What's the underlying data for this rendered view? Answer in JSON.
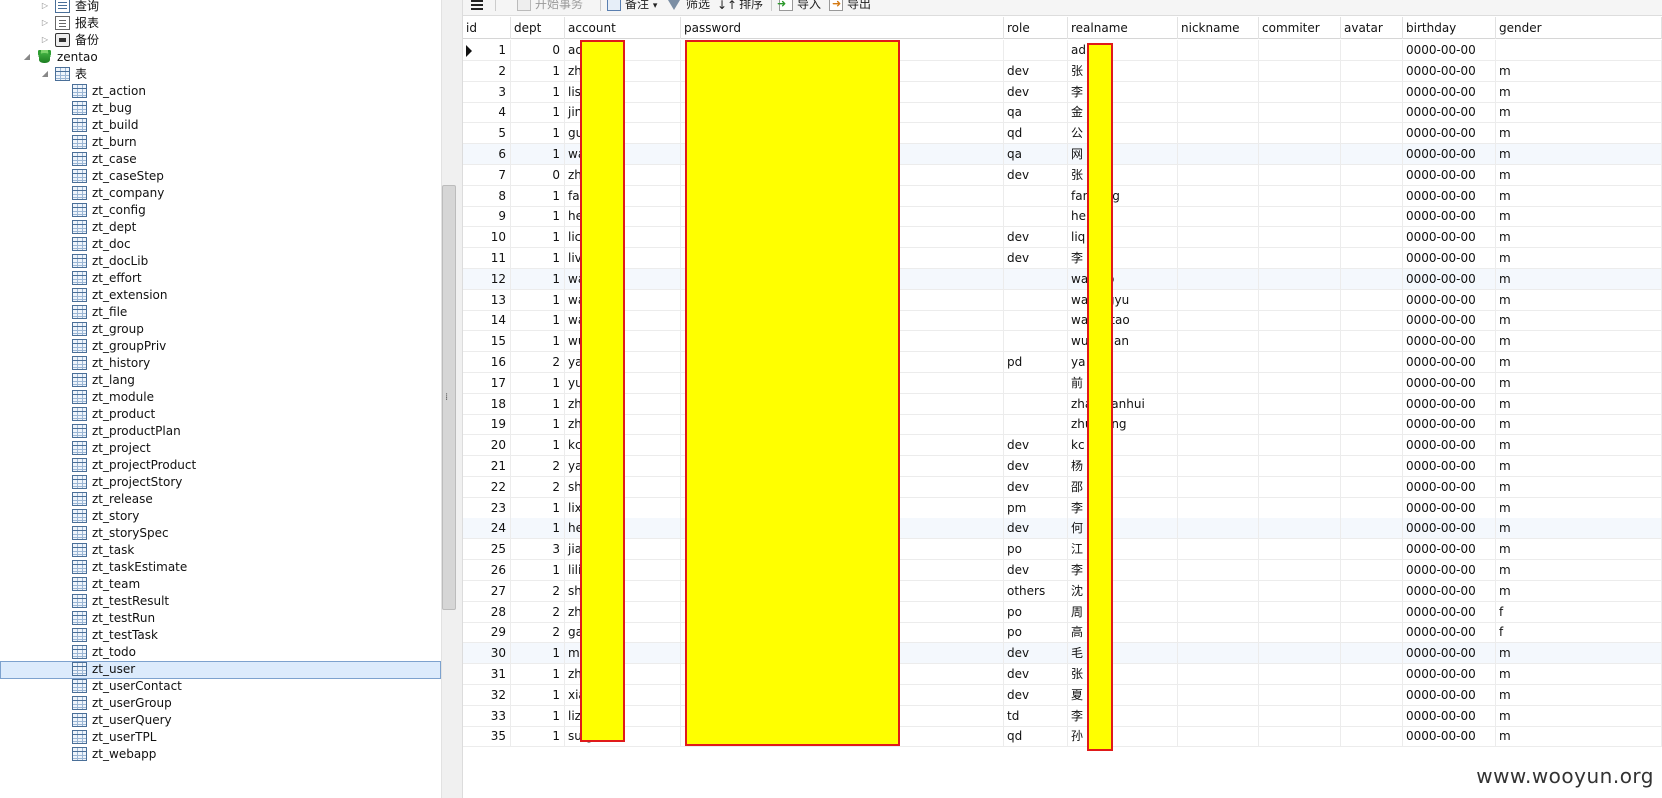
{
  "tree": {
    "top_items": [
      {
        "label": "查询",
        "icon": "query-icon"
      },
      {
        "label": "报表",
        "icon": "report-icon"
      },
      {
        "label": "备份",
        "icon": "backup-icon"
      }
    ],
    "database": {
      "label": "zentao",
      "icon": "database-icon"
    },
    "tables_folder": {
      "label": "表",
      "icon": "table-folder-icon"
    },
    "tables": [
      "zt_action",
      "zt_bug",
      "zt_build",
      "zt_burn",
      "zt_case",
      "zt_caseStep",
      "zt_company",
      "zt_config",
      "zt_dept",
      "zt_doc",
      "zt_docLib",
      "zt_effort",
      "zt_extension",
      "zt_file",
      "zt_group",
      "zt_groupPriv",
      "zt_history",
      "zt_lang",
      "zt_module",
      "zt_product",
      "zt_productPlan",
      "zt_project",
      "zt_projectProduct",
      "zt_projectStory",
      "zt_release",
      "zt_story",
      "zt_storySpec",
      "zt_task",
      "zt_taskEstimate",
      "zt_team",
      "zt_testResult",
      "zt_testRun",
      "zt_testTask",
      "zt_todo",
      "zt_user",
      "zt_userContact",
      "zt_userGroup",
      "zt_userQuery",
      "zt_userTPL",
      "zt_webapp"
    ],
    "selected_table": "zt_user"
  },
  "toolbar": {
    "begin_transaction": "开始事务",
    "memo": "备注",
    "filter": "筛选",
    "sort": "排序",
    "import": "导入",
    "export": "导出"
  },
  "grid": {
    "columns": [
      "id",
      "dept",
      "account",
      "password",
      "role",
      "realname",
      "nickname",
      "commiter",
      "avatar",
      "birthday",
      "gender"
    ],
    "rows": [
      {
        "id": "1",
        "dept": "0",
        "account": "ad",
        "role": "",
        "realname": "ad",
        "birthday": "0000-00-00",
        "gender": ""
      },
      {
        "id": "2",
        "dept": "1",
        "account": "zh          gliang",
        "role": "dev",
        "realname": "张",
        "birthday": "0000-00-00",
        "gender": "m"
      },
      {
        "id": "3",
        "dept": "1",
        "account": "lis",
        "role": "dev",
        "realname": "李",
        "birthday": "0000-00-00",
        "gender": "m"
      },
      {
        "id": "4",
        "dept": "1",
        "account": "jin",
        "role": "qa",
        "realname": "金",
        "birthday": "0000-00-00",
        "gender": "m"
      },
      {
        "id": "5",
        "dept": "1",
        "account": "gu",
        "role": "qd",
        "realname": "公       号",
        "birthday": "0000-00-00",
        "gender": "m"
      },
      {
        "id": "6",
        "dept": "1",
        "account": "wa",
        "role": "qa",
        "realname": "网",
        "birthday": "0000-00-00",
        "gender": "m"
      },
      {
        "id": "7",
        "dept": "0",
        "account": "zh          cong",
        "role": "dev",
        "realname": "张",
        "birthday": "0000-00-00",
        "gender": "m"
      },
      {
        "id": "8",
        "dept": "1",
        "account": "fa            g",
        "role": "",
        "realname": "fan      iong",
        "birthday": "0000-00-00",
        "gender": "m"
      },
      {
        "id": "9",
        "dept": "1",
        "account": "he",
        "role": "",
        "realname": "he",
        "birthday": "0000-00-00",
        "gender": "m"
      },
      {
        "id": "10",
        "dept": "1",
        "account": "lic",
        "role": "dev",
        "realname": "liq",
        "birthday": "0000-00-00",
        "gender": "m"
      },
      {
        "id": "11",
        "dept": "1",
        "account": "liv",
        "role": "dev",
        "realname": "李",
        "birthday": "0000-00-00",
        "gender": "m"
      },
      {
        "id": "12",
        "dept": "1",
        "account": "wa",
        "role": "",
        "realname": "wa       nao",
        "birthday": "0000-00-00",
        "gender": "m"
      },
      {
        "id": "13",
        "dept": "1",
        "account": "wa          gyu",
        "role": "",
        "realname": "wa       ongyu",
        "birthday": "0000-00-00",
        "gender": "m"
      },
      {
        "id": "14",
        "dept": "1",
        "account": "wa          tao",
        "role": "",
        "realname": "wa       iantao",
        "birthday": "0000-00-00",
        "gender": "m"
      },
      {
        "id": "15",
        "dept": "1",
        "account": "wu          uan",
        "role": "",
        "realname": "wu      chuan",
        "birthday": "0000-00-00",
        "gender": "m"
      },
      {
        "id": "16",
        "dept": "2",
        "account": "ya",
        "role": "pd",
        "realname": "ya",
        "birthday": "0000-00-00",
        "gender": "m"
      },
      {
        "id": "17",
        "dept": "1",
        "account": "yu",
        "role": "",
        "realname": "前",
        "birthday": "0000-00-00",
        "gender": "m"
      },
      {
        "id": "18",
        "dept": "1",
        "account": "zh           anhui",
        "role": "",
        "realname": "zha      huanhui",
        "birthday": "0000-00-00",
        "gender": "m"
      },
      {
        "id": "19",
        "dept": "1",
        "account": "zh           ng",
        "role": "",
        "realname": "zhu      heng",
        "birthday": "0000-00-00",
        "gender": "m"
      },
      {
        "id": "20",
        "dept": "1",
        "account": "kc",
        "role": "dev",
        "realname": "kc",
        "birthday": "0000-00-00",
        "gender": "m"
      },
      {
        "id": "21",
        "dept": "2",
        "account": "ya",
        "role": "dev",
        "realname": "杨",
        "birthday": "0000-00-00",
        "gender": "m"
      },
      {
        "id": "22",
        "dept": "2",
        "account": "sh",
        "role": "dev",
        "realname": "邵",
        "birthday": "0000-00-00",
        "gender": "m"
      },
      {
        "id": "23",
        "dept": "1",
        "account": "lix",
        "role": "pm",
        "realname": "李",
        "birthday": "0000-00-00",
        "gender": "m"
      },
      {
        "id": "24",
        "dept": "1",
        "account": "he",
        "role": "dev",
        "realname": "何",
        "birthday": "0000-00-00",
        "gender": "m"
      },
      {
        "id": "25",
        "dept": "3",
        "account": "jia           n",
        "role": "po",
        "realname": "江",
        "birthday": "0000-00-00",
        "gender": "m"
      },
      {
        "id": "26",
        "dept": "1",
        "account": "lili",
        "role": "dev",
        "realname": "李",
        "birthday": "0000-00-00",
        "gender": "m"
      },
      {
        "id": "27",
        "dept": "2",
        "account": "sh          gqing",
        "role": "others",
        "realname": "沈",
        "birthday": "0000-00-00",
        "gender": "m"
      },
      {
        "id": "28",
        "dept": "2",
        "account": "zh",
        "role": "po",
        "realname": "周",
        "birthday": "0000-00-00",
        "gender": "f"
      },
      {
        "id": "29",
        "dept": "2",
        "account": "ga",
        "role": "po",
        "realname": "高",
        "birthday": "0000-00-00",
        "gender": "f"
      },
      {
        "id": "30",
        "dept": "1",
        "account": "m           n",
        "role": "dev",
        "realname": "毛",
        "birthday": "0000-00-00",
        "gender": "m"
      },
      {
        "id": "31",
        "dept": "1",
        "account": "zh",
        "role": "dev",
        "realname": "张",
        "birthday": "0000-00-00",
        "gender": "m"
      },
      {
        "id": "32",
        "dept": "1",
        "account": "xia",
        "role": "dev",
        "realname": "夏",
        "birthday": "0000-00-00",
        "gender": "m"
      },
      {
        "id": "33",
        "dept": "1",
        "account": "liz",
        "role": "td",
        "realname": "李",
        "birthday": "0000-00-00",
        "gender": "m"
      },
      {
        "id": "35",
        "dept": "1",
        "account": "su          g",
        "role": "qd",
        "realname": "孙",
        "birthday": "0000-00-00",
        "gender": "m"
      }
    ]
  },
  "watermark": "www.wooyun.org",
  "colors": {
    "redaction_fill": "#ffff00",
    "redaction_border": "#e01a1a",
    "selection": "#dcebfc"
  }
}
